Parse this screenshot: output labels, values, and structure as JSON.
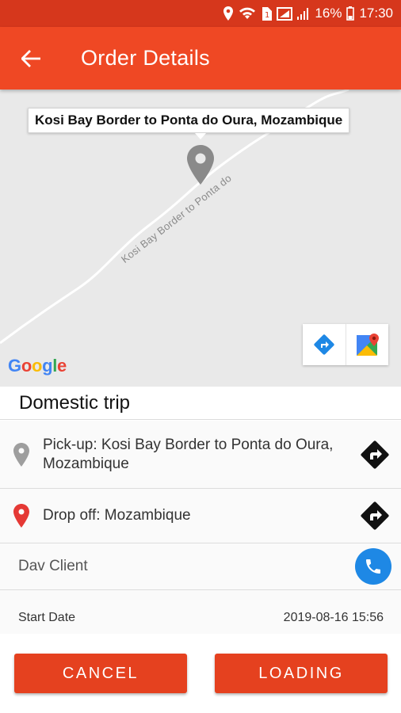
{
  "status_bar": {
    "battery": "16%",
    "time": "17:30"
  },
  "header": {
    "title": "Order Details"
  },
  "map": {
    "callout": "Kosi Bay Border to Ponta do Oura, Mozambique",
    "road_label": "Kosi Bay Border to Ponta do",
    "attribution": [
      "G",
      "o",
      "o",
      "g",
      "l",
      "e"
    ]
  },
  "trip": {
    "type": "Domestic trip"
  },
  "pickup": {
    "label": "Pick-up: Kosi Bay Border to Ponta do Oura, Mozambique"
  },
  "dropoff": {
    "label": "Drop off: Mozambique"
  },
  "client": {
    "name": "Dav Client"
  },
  "start_date": {
    "label": "Start Date",
    "value": "2019-08-16 15:56"
  },
  "actions": {
    "cancel": "CANCEL",
    "loading": "LOADING"
  },
  "colors": {
    "primary": "#ef4824",
    "status_bar": "#d6371c",
    "call": "#1e88e5",
    "dropoff_pin": "#e53935"
  }
}
